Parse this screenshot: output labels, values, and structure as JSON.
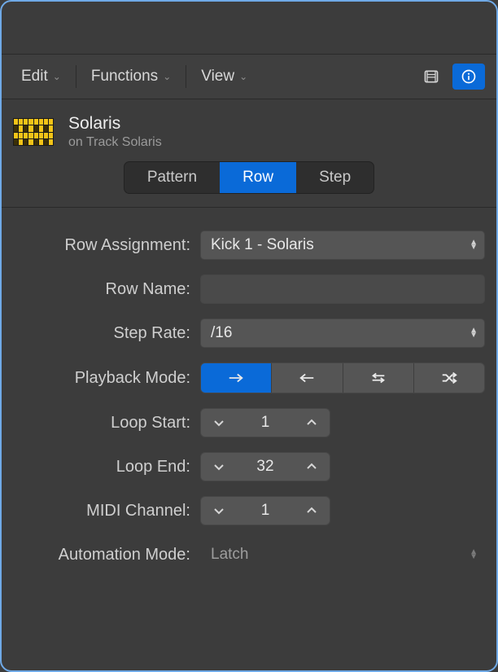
{
  "toolbar": {
    "edit": "Edit",
    "functions": "Functions",
    "view": "View"
  },
  "region": {
    "name": "Solaris",
    "subtitle": "on Track Solaris"
  },
  "tabs": {
    "pattern": "Pattern",
    "row": "Row",
    "step": "Step",
    "active": "row"
  },
  "fields": {
    "rowAssignment": {
      "label": "Row Assignment:",
      "value": "Kick 1 - Solaris"
    },
    "rowName": {
      "label": "Row Name:",
      "value": ""
    },
    "stepRate": {
      "label": "Step Rate:",
      "value": "/16"
    },
    "playbackMode": {
      "label": "Playback Mode:",
      "selected": "forward"
    },
    "loopStart": {
      "label": "Loop Start:",
      "value": "1"
    },
    "loopEnd": {
      "label": "Loop End:",
      "value": "32"
    },
    "midiChannel": {
      "label": "MIDI Channel:",
      "value": "1"
    },
    "automationMode": {
      "label": "Automation Mode:",
      "value": "Latch"
    }
  }
}
